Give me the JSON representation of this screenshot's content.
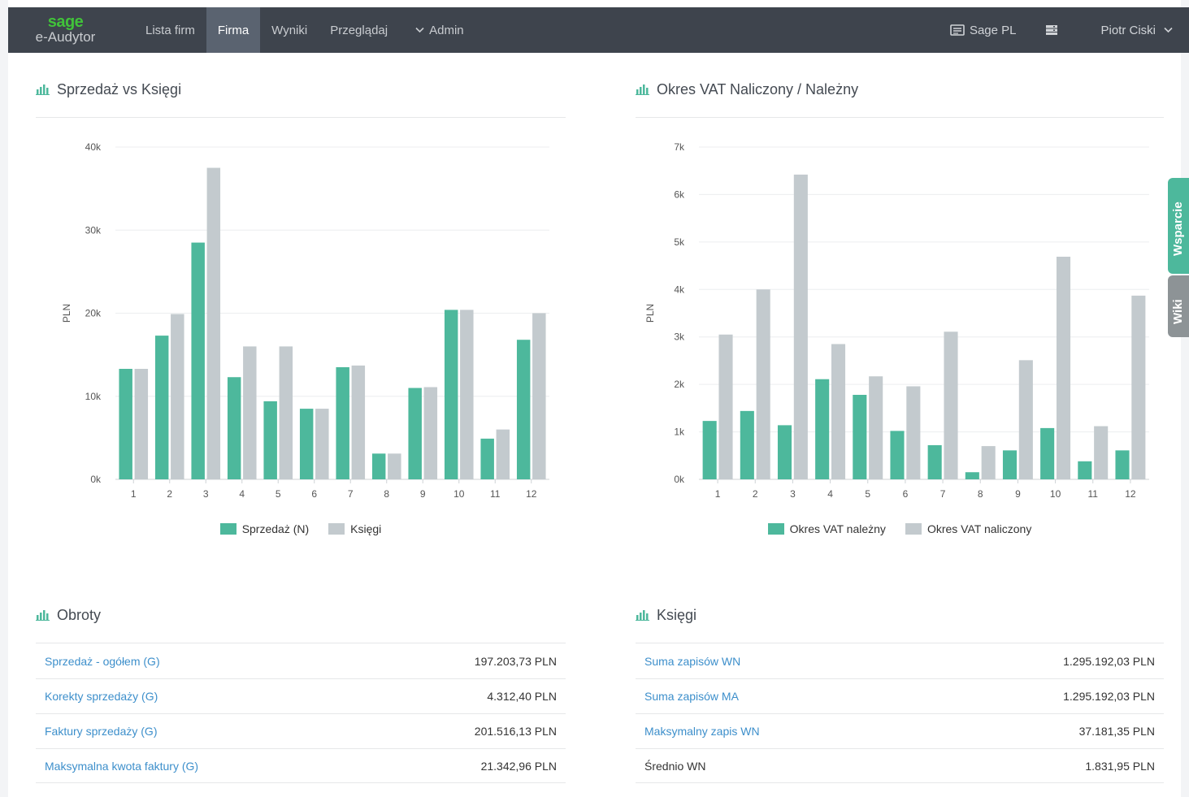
{
  "nav": {
    "brand_logo": "sage",
    "brand_name": "e-Audytor",
    "items": [
      {
        "label": "Lista firm",
        "active": false
      },
      {
        "label": "Firma",
        "active": true
      },
      {
        "label": "Wyniki",
        "active": false
      },
      {
        "label": "Przeglądaj",
        "active": false
      }
    ],
    "admin_label": "Admin",
    "company_label": "Sage PL",
    "user_label": "Piotr Ciski"
  },
  "side_tabs": {
    "support": "Wsparcie",
    "wiki": "Wiki"
  },
  "colors": {
    "teal": "#4db89c",
    "grey": "#c3cace",
    "link": "#3d8fcb",
    "navbar": "#3e444d"
  },
  "panels": {
    "sales": {
      "title": "Sprzedaż vs Księgi"
    },
    "vat": {
      "title": "Okres VAT Naliczony / Należny"
    },
    "turnover": {
      "title": "Obroty"
    },
    "books": {
      "title": "Księgi"
    }
  },
  "chart_data": [
    {
      "type": "bar",
      "categories": [
        "1",
        "2",
        "3",
        "4",
        "5",
        "6",
        "7",
        "8",
        "9",
        "10",
        "11",
        "12"
      ],
      "series": [
        {
          "name": "Sprzedaż (N)",
          "color": "#4db89c",
          "values": [
            13300,
            17300,
            28500,
            12300,
            9400,
            8500,
            13500,
            3100,
            11000,
            20400,
            4900,
            16800
          ]
        },
        {
          "name": "Księgi",
          "color": "#c3cace",
          "values": [
            13300,
            19900,
            37500,
            16000,
            16000,
            8500,
            13700,
            3100,
            11100,
            20400,
            6000,
            20000
          ]
        }
      ],
      "ylabel": "PLN",
      "ylim": [
        0,
        40000
      ],
      "yticks": [
        0,
        10000,
        20000,
        30000,
        40000
      ],
      "ytick_labels": [
        "0k",
        "10k",
        "20k",
        "30k",
        "40k"
      ],
      "grid": true,
      "legend": "bottom"
    },
    {
      "type": "bar",
      "categories": [
        "1",
        "2",
        "3",
        "4",
        "5",
        "6",
        "7",
        "8",
        "9",
        "10",
        "11",
        "12"
      ],
      "series": [
        {
          "name": "Okres VAT należny",
          "color": "#4db89c",
          "values": [
            1230,
            1440,
            1140,
            2110,
            1780,
            1020,
            720,
            150,
            610,
            1080,
            380,
            610
          ]
        },
        {
          "name": "Okres VAT naliczony",
          "color": "#c3cace",
          "values": [
            3050,
            4000,
            6420,
            2850,
            2170,
            1960,
            3110,
            700,
            2510,
            4690,
            1120,
            3870
          ]
        }
      ],
      "ylabel": "PLN",
      "ylim": [
        0,
        7000
      ],
      "yticks": [
        0,
        1000,
        2000,
        3000,
        4000,
        5000,
        6000,
        7000
      ],
      "ytick_labels": [
        "0k",
        "1k",
        "2k",
        "3k",
        "4k",
        "5k",
        "6k",
        "7k"
      ],
      "grid": true,
      "legend": "bottom"
    }
  ],
  "turnover_rows": [
    {
      "label": "Sprzedaż - ogółem (G)",
      "value": "197.203,73 PLN",
      "link": true
    },
    {
      "label": "Korekty sprzedaży (G)",
      "value": "4.312,40 PLN",
      "link": true
    },
    {
      "label": "Faktury sprzedaży (G)",
      "value": "201.516,13 PLN",
      "link": true
    },
    {
      "label": "Maksymalna kwota faktury (G)",
      "value": "21.342,96 PLN",
      "link": true
    }
  ],
  "books_rows": [
    {
      "label": "Suma zapisów WN",
      "value": "1.295.192,03 PLN",
      "link": true
    },
    {
      "label": "Suma zapisów MA",
      "value": "1.295.192,03 PLN",
      "link": true
    },
    {
      "label": "Maksymalny zapis WN",
      "value": "37.181,35 PLN",
      "link": true
    },
    {
      "label": "Średnio WN",
      "value": "1.831,95 PLN",
      "link": false
    }
  ]
}
